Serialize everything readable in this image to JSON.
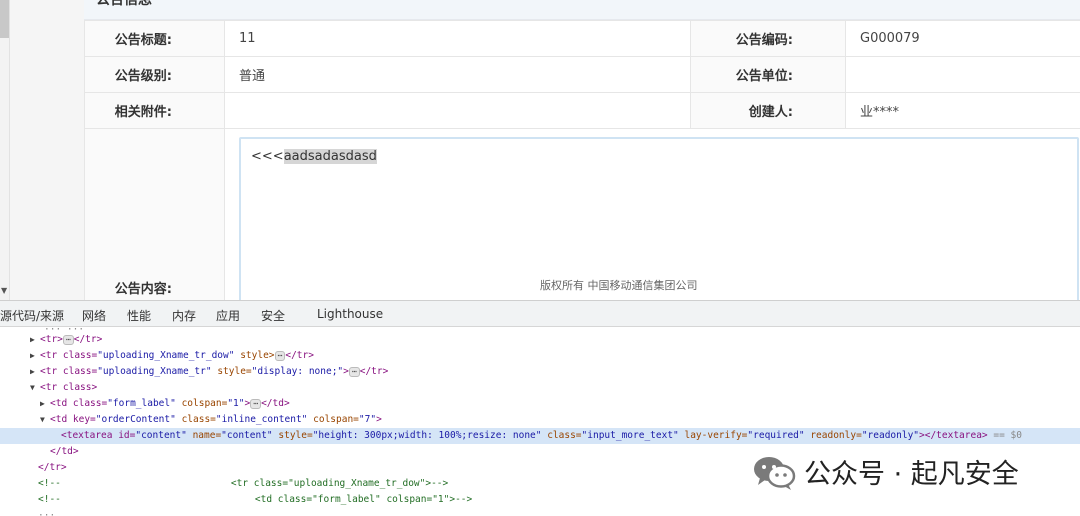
{
  "section": {
    "title": "公告信息"
  },
  "info": {
    "title_label": "公告标题:",
    "title_value": "11",
    "code_label": "公告编码:",
    "code_value": "G000079",
    "level_label": "公告级别:",
    "level_value": "普通",
    "unit_label": "公告单位:",
    "unit_value": "",
    "attach_label": "相关附件:",
    "attach_value": "",
    "creator_label": "创建人:",
    "creator_value": "业****",
    "content_label": "公告内容:",
    "content_prefix": "<<<",
    "content_selected": "aadsadasdasd"
  },
  "footer": "版权所有 中国移动通信集团公司",
  "devtools": {
    "tabs": [
      "源代码/来源",
      "网络",
      "性能",
      "内存",
      "应用",
      "安全",
      "Lighthouse"
    ],
    "lines": {
      "l1_a": "<tr>",
      "l1_b": "</tr>",
      "l2_a": "<tr class=",
      "l2_v": "\"uploading_Xname_tr_dow\"",
      "l2_b": " style>",
      "l2_c": "</tr>",
      "l3_a": "<tr class=",
      "l3_v": "\"uploading_Xname_tr\"",
      "l3_s": " style=",
      "l3_sv": "\"display: none;\"",
      "l3_b": ">",
      "l3_c": "</tr>",
      "l4": "<tr class>",
      "l5_a": "<td class=",
      "l5_v": "\"form_label\"",
      "l5_n": " colspan=",
      "l5_nv": "\"1\"",
      "l5_b": ">",
      "l5_c": "</td>",
      "l6_a": "<td key=",
      "l6_v": "\"orderContent\"",
      "l6_n": " class=",
      "l6_nv": "\"inline_content\"",
      "l6_m": " colspan=",
      "l6_mv": "\"7\"",
      "l6_b": ">",
      "l7_a": "<textarea id=",
      "l7_v1": "\"content\"",
      "l7_n2": " name=",
      "l7_v2": "\"content\"",
      "l7_n3": " style=",
      "l7_v3": "\"height: 300px;width: 100%;resize: none\"",
      "l7_n4": " class=",
      "l7_v4": "\"input_more_text\"",
      "l7_n5": " lay-verify=",
      "l7_v5": "\"required\"",
      "l7_n6": " readonly=",
      "l7_v6": "\"readonly\"",
      "l7_b": "></textarea>",
      "l7_eq": " == $0",
      "l8": "</td>",
      "l9": "</tr>",
      "l10_a": "<!--",
      "l10_b": "<tr class=\"uploading_Xname_tr_dow\">-->",
      "l11_a": "<!--",
      "l11_b": "<td class=\"form_label\" colspan=\"1\">-->"
    }
  },
  "watermark": {
    "text": "公众号 · 起凡安全",
    "icon": "wechat-icon"
  },
  "colors": {
    "selected_row": "#d5e5f7",
    "tag": "#881280",
    "attr_name": "#994500",
    "attr_value": "#1a1aa6",
    "comment": "#236e25"
  }
}
